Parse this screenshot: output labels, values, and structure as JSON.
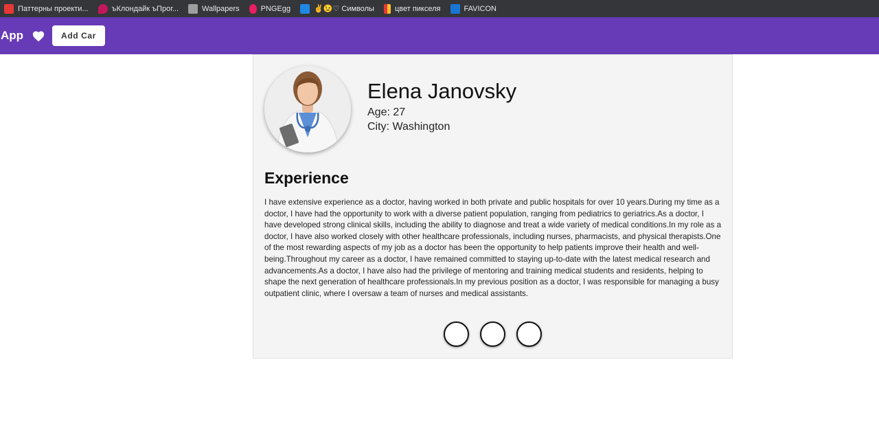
{
  "bookmarks": [
    {
      "label": "Паттерны проекти...",
      "icon": "red-square-icon",
      "color": "#e53935"
    },
    {
      "label": "ъКлондайк ъПрог...",
      "icon": "heart-gem-icon",
      "color": "#c2185b"
    },
    {
      "label": "Wallpapers",
      "icon": "wallpapers-icon",
      "color": "#9e9e9e"
    },
    {
      "label": "PNGEgg",
      "icon": "pngegg-icon",
      "color": "#e91e63"
    },
    {
      "label": "✌😉♡ Символы",
      "icon": "v-shield-icon",
      "color": "#1e88e5"
    },
    {
      "label": "цвет пикселя",
      "icon": "color-blocks-icon",
      "color": "#fbc02d"
    },
    {
      "label": "FAVICON",
      "icon": "favicon-f-icon",
      "color": "#1976d2"
    }
  ],
  "header": {
    "title": "App",
    "add_button": "Add Car",
    "color": "#673ab7"
  },
  "profile": {
    "name": "Elena Janovsky",
    "age": "Age: 27",
    "city": "City: Washington",
    "avatar": "doctor-photo"
  },
  "experience": {
    "title": "Experience",
    "text": "I have extensive experience as a doctor, having worked in both private and public hospitals for over 10 years.During my time as a doctor, I have had the opportunity to work with a diverse patient population, ranging from pediatrics to geriatrics.As a doctor, I have developed strong clinical skills, including the ability to diagnose and treat a wide variety of medical conditions.In my role as a doctor, I have also worked closely with other healthcare professionals, including nurses, pharmacists, and physical therapists.One of the most rewarding aspects of my job as a doctor has been the opportunity to help patients improve their health and well-being.Throughout my career as a doctor, I have remained committed to staying up-to-date with the latest medical research and advancements.As a doctor, I have also had the privilege of mentoring and training medical students and residents, helping to shape the next generation of healthcare professionals.In my previous position as a doctor, I was responsible for managing a busy outpatient clinic, where I oversaw a team of nurses and medical assistants."
  }
}
